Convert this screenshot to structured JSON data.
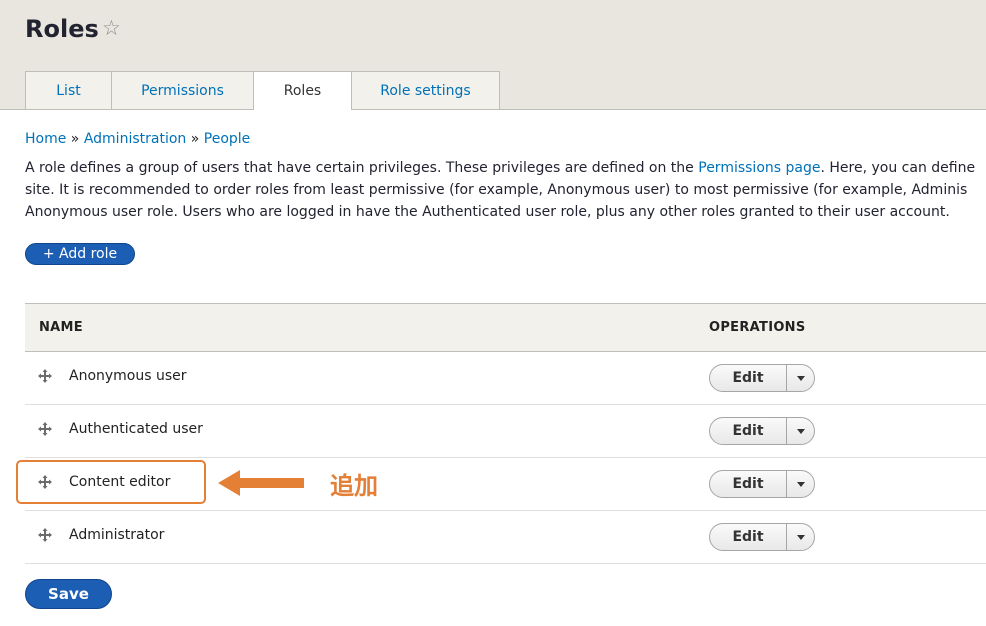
{
  "header": {
    "title": "Roles",
    "tabs": [
      {
        "label": "List"
      },
      {
        "label": "Permissions"
      },
      {
        "label": "Roles"
      },
      {
        "label": "Role settings"
      }
    ]
  },
  "breadcrumb": {
    "home": "Home",
    "sep": "»",
    "administration": "Administration",
    "people": "People"
  },
  "description": {
    "line1_a": "A role defines a group of users that have certain privileges. These privileges are defined on the ",
    "line1_link": "Permissions page",
    "line1_b": ". Here, you can define",
    "line2": "site. It is recommended to order roles from least permissive (for example, Anonymous user) to most permissive (for example, Adminis",
    "line3": "Anonymous user role. Users who are logged in have the Authenticated user role, plus any other roles granted to their user account."
  },
  "add_role_label": "+ Add role",
  "table": {
    "col_name": "NAME",
    "col_operations": "OPERATIONS",
    "rows": [
      {
        "name": "Anonymous user",
        "operation": "Edit"
      },
      {
        "name": "Authenticated user",
        "operation": "Edit"
      },
      {
        "name": "Content editor",
        "operation": "Edit"
      },
      {
        "name": "Administrator",
        "operation": "Edit"
      }
    ]
  },
  "annotation": {
    "text": "追加",
    "color": "#e47f36"
  },
  "save_label": "Save",
  "colors": {
    "link": "#0071b8",
    "primary_button": "#1b5eb4",
    "header_bg": "#e8e6df"
  }
}
